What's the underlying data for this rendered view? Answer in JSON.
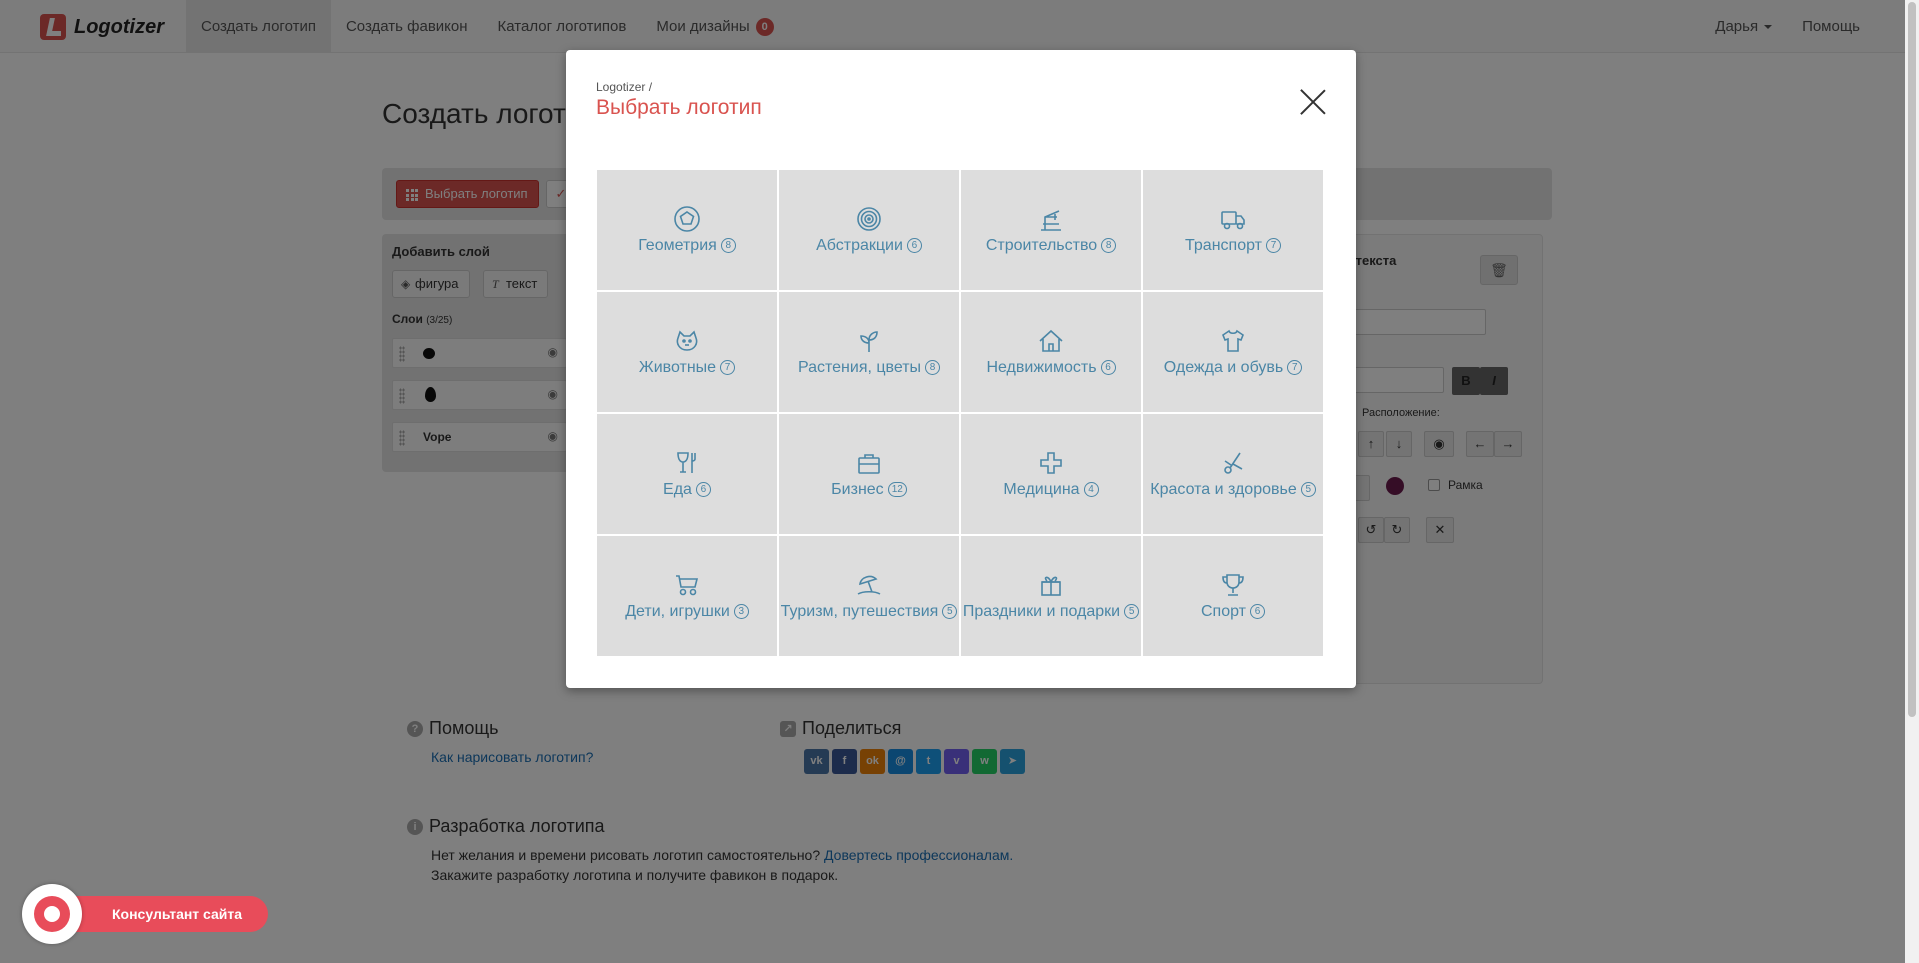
{
  "navbar": {
    "brand": "Logotizer",
    "items": [
      {
        "label": "Создать логотип",
        "active": true
      },
      {
        "label": "Создать фавикон"
      },
      {
        "label": "Каталог логотипов"
      },
      {
        "label": "Мои дизайны",
        "badge": "0"
      }
    ],
    "user": "Дарья",
    "help": "Помощь"
  },
  "page": {
    "title": "Создать логотип",
    "choose_button": "Выбрать логотип",
    "add_layer": "Добавить слой",
    "add_shape": "фигура",
    "add_text": "текст",
    "layers_title": "Слои",
    "layers_count": "(3/25)",
    "layers": [
      {
        "name": "",
        "kind": "blob"
      },
      {
        "name": "",
        "kind": "drop"
      },
      {
        "name": "Vope",
        "kind": "text"
      }
    ],
    "props_title": "и текста",
    "position_label": "Расположение:",
    "frame_label": "Рамка"
  },
  "footer": {
    "help_title": "Помощь",
    "help_link": "Как нарисовать логотип?",
    "share_title": "Поделиться",
    "share_buttons": [
      {
        "name": "vk",
        "glyph": "vk",
        "color": "#4a76a8"
      },
      {
        "name": "facebook",
        "glyph": "f",
        "color": "#3b5998"
      },
      {
        "name": "odnoklassniki",
        "glyph": "ok",
        "color": "#ee8208"
      },
      {
        "name": "moimir",
        "glyph": "@",
        "color": "#168de2"
      },
      {
        "name": "twitter",
        "glyph": "t",
        "color": "#1da1f2"
      },
      {
        "name": "viber",
        "glyph": "v",
        "color": "#7360f2"
      },
      {
        "name": "whatsapp",
        "glyph": "w",
        "color": "#25d366"
      },
      {
        "name": "telegram",
        "glyph": "➤",
        "color": "#2aa3df"
      }
    ],
    "dev_title": "Разработка логотипа",
    "dev_text_1": "Нет желания и времени рисовать логотип самостоятельно?",
    "dev_link": "Довертесь профессионалам.",
    "dev_text_2": "Закажите разработку логотипа и получите фавикон в подарок."
  },
  "consultant": {
    "label": "Консультант сайта"
  },
  "modal": {
    "breadcrumb": "Logotizer /",
    "title": "Выбрать логотип",
    "categories": [
      {
        "label": "Геометрия",
        "count": "8",
        "icon": "pentagon-icon"
      },
      {
        "label": "Абстракции",
        "count": "6",
        "icon": "spiral-icon"
      },
      {
        "label": "Строительство",
        "count": "8",
        "icon": "crane-icon"
      },
      {
        "label": "Транспорт",
        "count": "7",
        "icon": "truck-icon"
      },
      {
        "label": "Животные",
        "count": "7",
        "icon": "animal-icon"
      },
      {
        "label": "Растения, цветы",
        "count": "8",
        "icon": "sprout-icon"
      },
      {
        "label": "Недвижимость",
        "count": "6",
        "icon": "house-icon"
      },
      {
        "label": "Одежда и обувь",
        "count": "7",
        "icon": "shirt-icon"
      },
      {
        "label": "Еда",
        "count": "6",
        "icon": "glass-fork-icon"
      },
      {
        "label": "Бизнес",
        "count": "12",
        "icon": "briefcase-icon"
      },
      {
        "label": "Медицина",
        "count": "4",
        "icon": "cross-icon"
      },
      {
        "label": "Красота и здоровье",
        "count": "5",
        "icon": "scissors-icon"
      },
      {
        "label": "Дети, игрушки",
        "count": "3",
        "icon": "stroller-icon"
      },
      {
        "label": "Туризм, путешествия",
        "count": "5",
        "icon": "umbrella-icon"
      },
      {
        "label": "Праздники и подарки",
        "count": "5",
        "icon": "gift-icon"
      },
      {
        "label": "Спорт",
        "count": "6",
        "icon": "trophy-icon"
      }
    ]
  }
}
